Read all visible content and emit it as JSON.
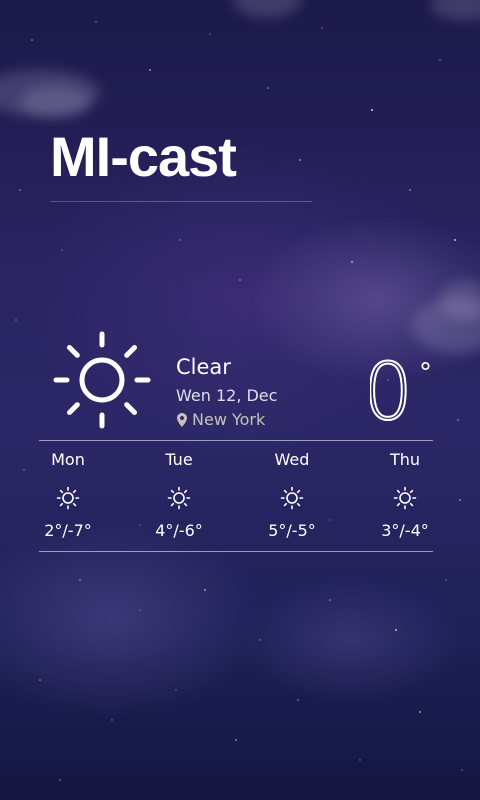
{
  "app": {
    "title": "MI-cast"
  },
  "current": {
    "condition": "Clear",
    "date": "Wen 12, Dec",
    "location": "New York",
    "temperature": "0",
    "unit_symbol": "°",
    "icon": "sun-icon"
  },
  "forecast": [
    {
      "day": "Mon",
      "range": "2°/-7°",
      "icon": "sun-icon"
    },
    {
      "day": "Tue",
      "range": "4°/-6°",
      "icon": "sun-icon"
    },
    {
      "day": "Wed",
      "range": "5°/-5°",
      "icon": "sun-icon"
    },
    {
      "day": "Thu",
      "range": "3°/-4°",
      "icon": "sun-icon"
    }
  ],
  "colors": {
    "background_top": "#1c1a4a",
    "background_bottom": "#141640",
    "text": "#ffffff"
  }
}
